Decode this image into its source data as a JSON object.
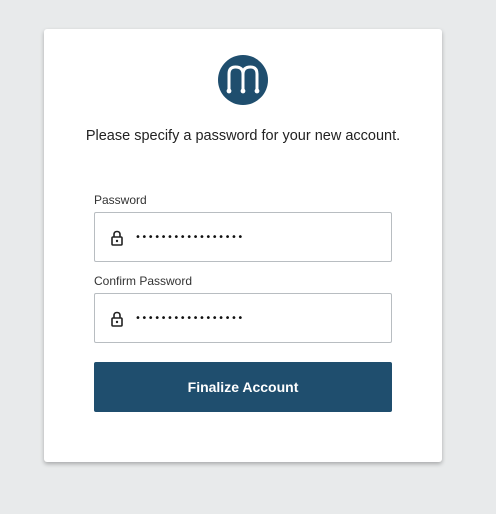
{
  "logo": {
    "icon": "mesosphere-m-logo-icon",
    "color": "#1f4e6e"
  },
  "instructions": "Please specify a password for your new account.",
  "password": {
    "label": "Password",
    "value": "•••••••••••••••••",
    "icon": "lock-icon"
  },
  "confirm_password": {
    "label": "Confirm Password",
    "value": "•••••••••••••••••",
    "icon": "lock-icon"
  },
  "submit": {
    "label": "Finalize Account",
    "color": "#1f4e6e"
  }
}
